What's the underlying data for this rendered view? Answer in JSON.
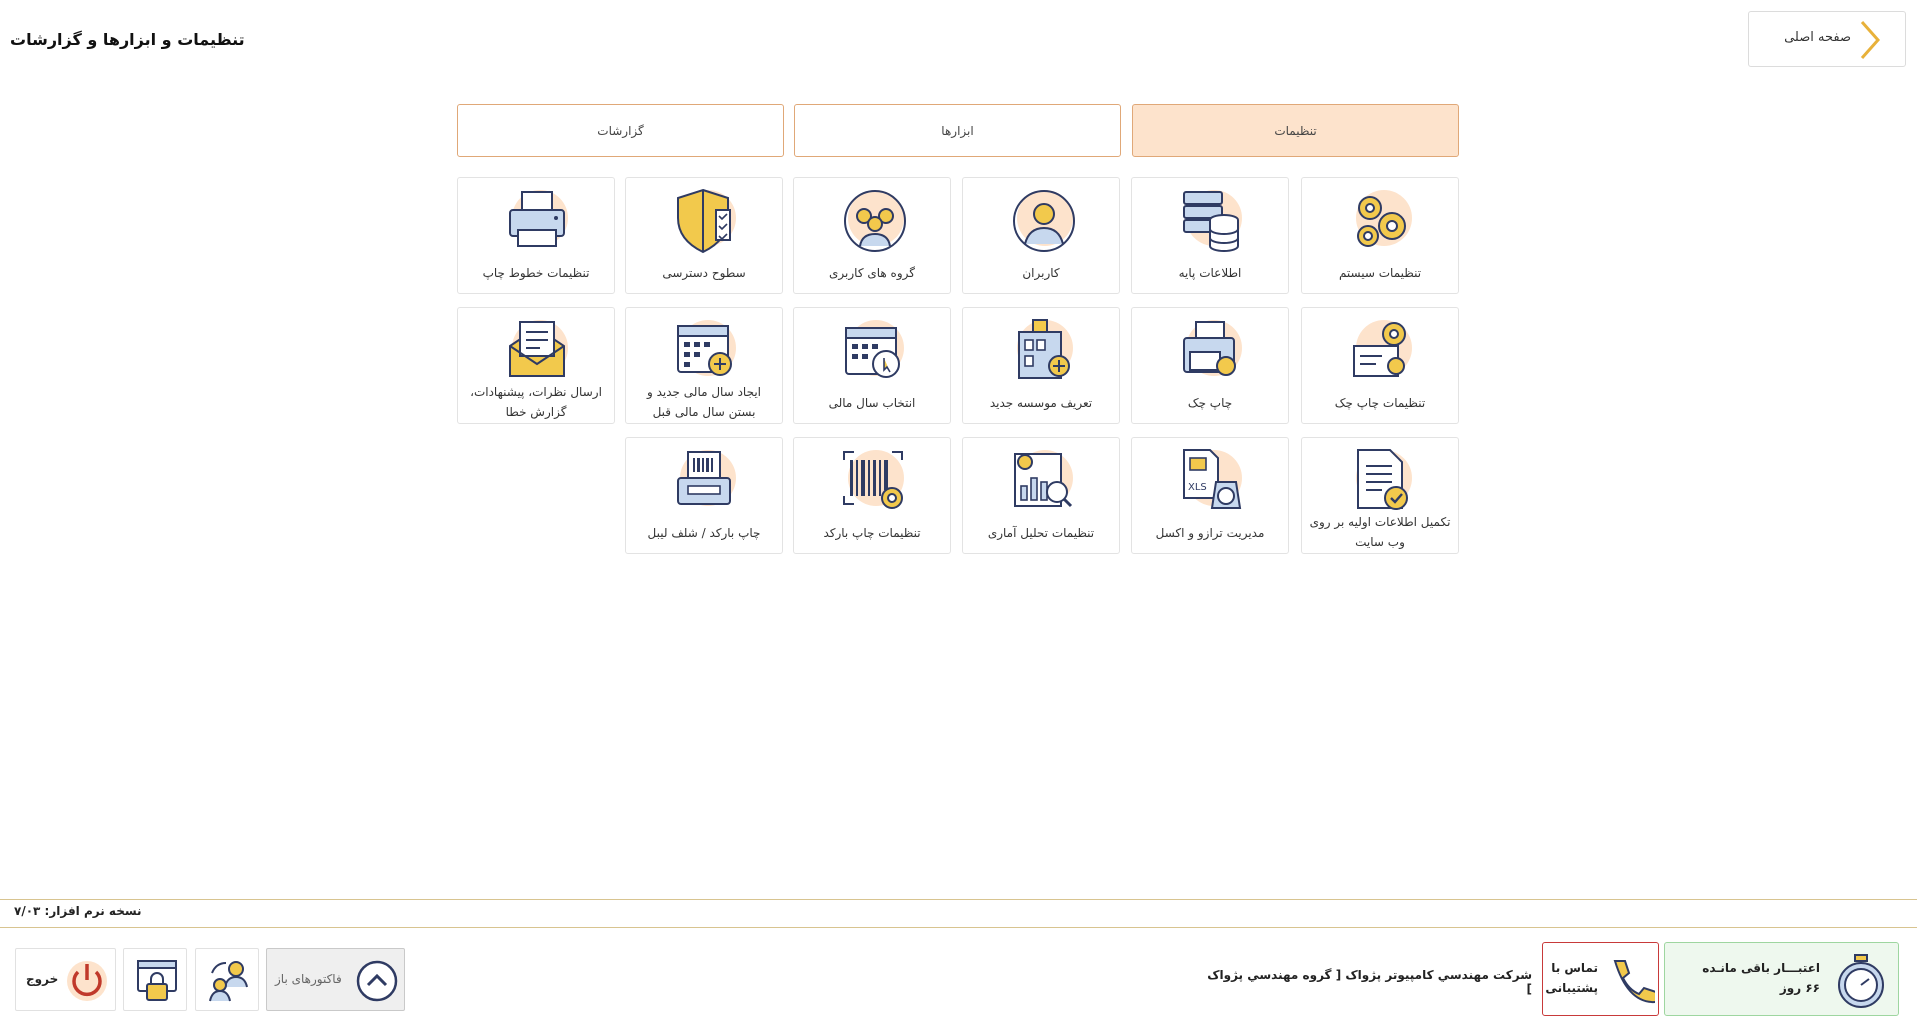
{
  "header": {
    "title": "تنظیمات و ابزارها و گزارشات",
    "home_label": "صفحه اصلی"
  },
  "tabs": [
    {
      "label": "تنظیمات",
      "active": true
    },
    {
      "label": "ابزارها",
      "active": false
    },
    {
      "label": "گزارشات",
      "active": false
    }
  ],
  "tiles": {
    "system_settings": {
      "label": "تنظیمات سیستم",
      "icon": "gears-icon"
    },
    "base_info": {
      "label": "اطلاعات پایه",
      "icon": "database-icon"
    },
    "users": {
      "label": "کاربران",
      "icon": "user-icon"
    },
    "user_groups": {
      "label": "گروه های کاربری",
      "icon": "user-group-icon"
    },
    "access_levels": {
      "label": "سطوح دسترسی",
      "icon": "shield-icon"
    },
    "print_font_settings": {
      "label": "تنظیمات خطوط چاپ",
      "icon": "printer-icon"
    },
    "check_print_settings": {
      "label": "تنظیمات چاپ چک",
      "icon": "check-settings-icon"
    },
    "print_check": {
      "label": "چاپ چک",
      "icon": "check-printer-icon"
    },
    "new_company": {
      "label": "تعریف موسسه جدید",
      "icon": "building-add-icon"
    },
    "select_fiscal_year": {
      "label": "انتخاب سال مالی",
      "icon": "calendar-pointer-icon"
    },
    "new_fiscal_year": {
      "line1": "ایجاد سال مالی جدید و",
      "line2": "بستن سال مالی قبل",
      "icon": "calendar-add-icon"
    },
    "feedback": {
      "line1": "ارسال نظرات، پیشنهادات،",
      "line2": "گزارش خطا",
      "icon": "envelope-icon"
    },
    "website_info": {
      "line1": "تکمیل اطلاعات اولیه بر روی",
      "line2": "وب سایت",
      "icon": "document-check-icon"
    },
    "balance_excel": {
      "label": "مدیریت ترازو و اکسل",
      "icon": "scale-excel-icon"
    },
    "stat_analysis": {
      "label": "تنظیمات تحلیل آماری",
      "icon": "analytics-icon"
    },
    "barcode_print_settings": {
      "label": "تنظیمات چاپ بارکد",
      "icon": "barcode-icon"
    },
    "barcode_label_print": {
      "label": "چاپ بارکد / شلف لیبل",
      "icon": "label-printer-icon"
    }
  },
  "footer": {
    "version": "نسخه نرم افزار: ۷/۰۳",
    "credit_line1": "اعتبـــار باقی مانـده",
    "credit_line2": "۶۶ روز",
    "support_line1": "تماس با",
    "support_line2": "پشتیبانی",
    "company": "شرکت مهندسي كامپيوتر پژواک [ گروه مهندسي پژواک ]",
    "open_invoices": "فاکتورهای باز",
    "exit": "خروج"
  },
  "colors": {
    "accent": "#fde3cc",
    "accent_border": "#e0a878",
    "icon_stroke": "#2f3b63",
    "icon_gold": "#f2c94c",
    "icon_blue": "#c7d8ee",
    "credit_bg": "#eef8ee",
    "support_border": "#c83a3a"
  }
}
